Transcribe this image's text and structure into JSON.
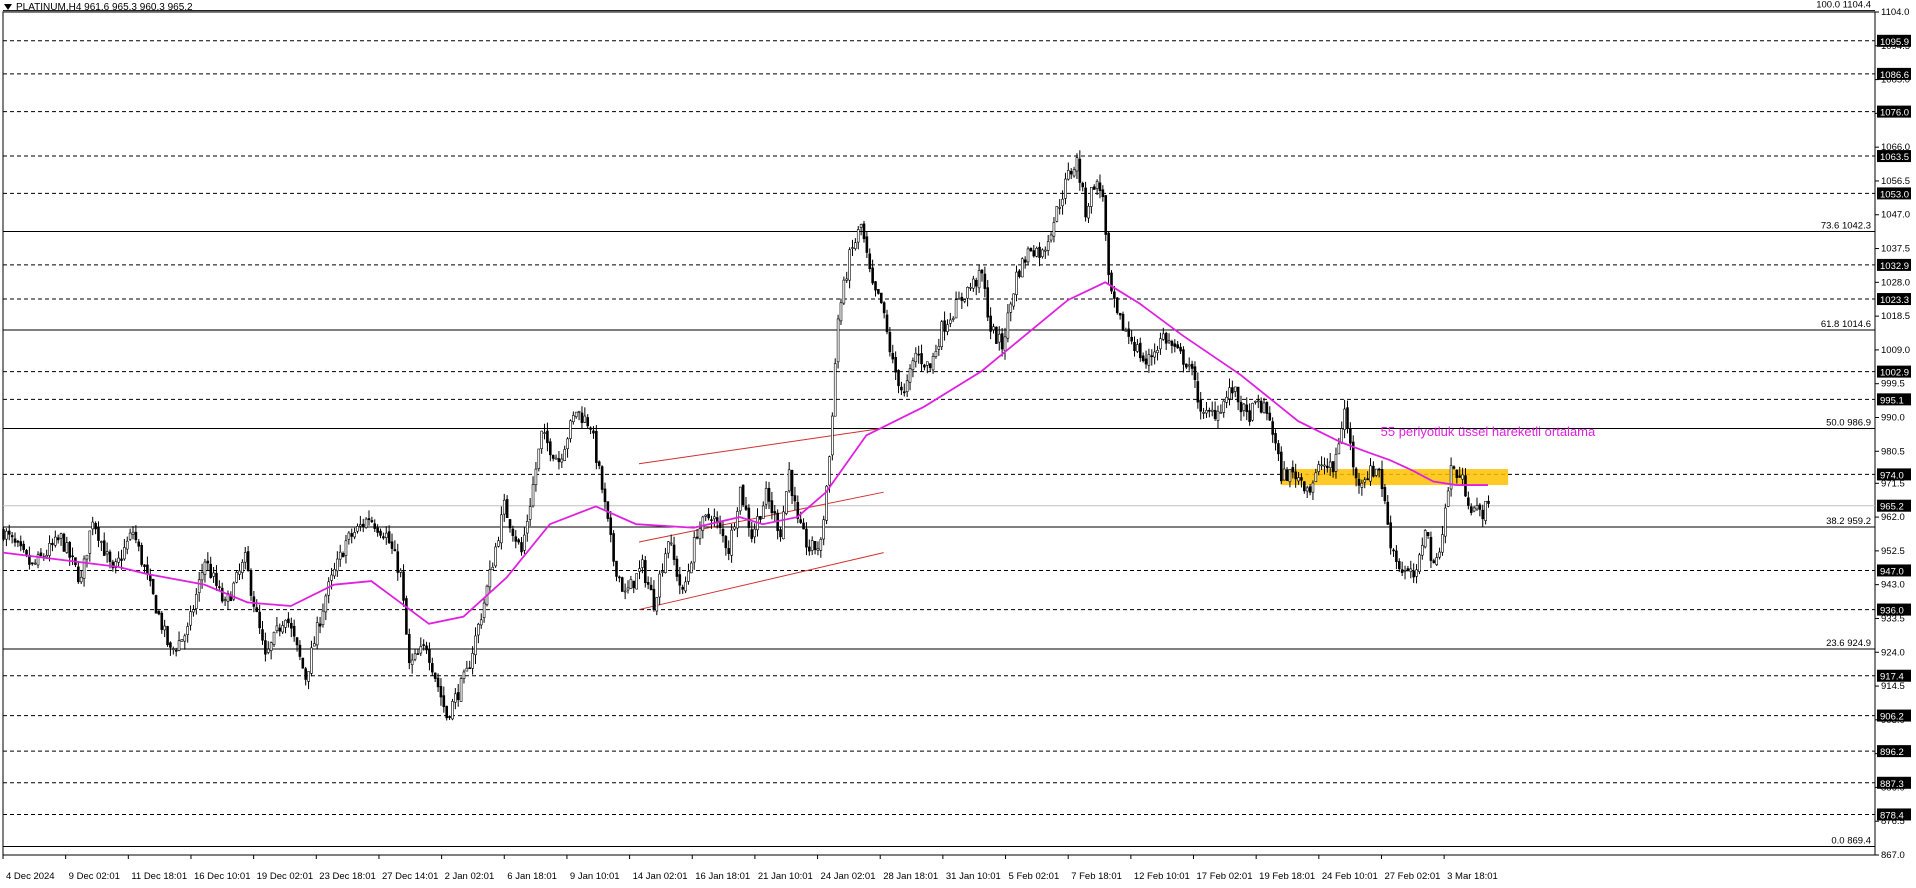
{
  "header": {
    "title": "PLATINUM,H4 961.6 965.3 960.3 965.2"
  },
  "annotation": {
    "ema_text": "55 periyotluk üssel hareketli ortalama",
    "ema_color": "#e020e0"
  },
  "colors": {
    "background": "#ffffff",
    "candles": "#000000",
    "ema": "#e020e0",
    "channel": "#d03030",
    "zone": "#ffc000",
    "grid": "#000000"
  },
  "chart_data": {
    "type": "candlestick",
    "ylim": [
      867.0,
      1104.0
    ],
    "x_tick_labels": [
      "4 Dec 2024",
      "9 Dec 02:01",
      "11 Dec 18:01",
      "16 Dec 10:01",
      "19 Dec 02:01",
      "23 Dec 18:01",
      "27 Dec 14:01",
      "2 Jan 02:01",
      "6 Jan 18:01",
      "9 Jan 10:01",
      "14 Jan 02:01",
      "16 Jan 18:01",
      "21 Jan 10:01",
      "24 Jan 02:01",
      "28 Jan 18:01",
      "31 Jan 10:01",
      "5 Feb 02:01",
      "7 Feb 18:01",
      "12 Feb 10:01",
      "17 Feb 02:01",
      "19 Feb 18:01",
      "24 Feb 10:01",
      "27 Feb 02:01",
      "3 Mar 18:01"
    ],
    "y_tick_labels": [
      1104.0,
      1094.5,
      1085.0,
      1075.5,
      1066.0,
      1056.5,
      1047.0,
      1037.5,
      1028.0,
      1018.5,
      1009.0,
      999.5,
      990.0,
      980.5,
      971.5,
      962.0,
      952.5,
      943.0,
      933.5,
      924.0,
      914.5,
      905.0,
      895.5,
      886.0,
      876.5,
      867.0
    ],
    "fib_levels": [
      {
        "label": "100.0 1104.4",
        "value": 1104.4
      },
      {
        "label": "73.6 1042.3",
        "value": 1042.3
      },
      {
        "label": "61.8 1014.6",
        "value": 1014.6
      },
      {
        "label": "50.0 986.9",
        "value": 986.9
      },
      {
        "label": "38.2 959.2",
        "value": 959.2
      },
      {
        "label": "23.6 924.9",
        "value": 924.9
      },
      {
        "label": "0.0 869.4",
        "value": 869.4
      }
    ],
    "horizontal_levels": [
      1095.9,
      1086.6,
      1076.0,
      1063.5,
      1053.0,
      1032.9,
      1023.3,
      1002.9,
      995.1,
      974.0,
      947.0,
      936.0,
      917.4,
      906.2,
      896.2,
      887.3,
      878.4
    ],
    "price_tags": [
      "1095.9",
      "1086.6",
      "1076.0",
      "1063.5",
      "1053.0",
      "1032.9",
      "1023.3",
      "1002.9",
      "995.1",
      "974.0",
      "965.2",
      "947.0",
      "936.0",
      "917.4",
      "906.2",
      "896.2",
      "887.3",
      "878.4"
    ],
    "current_price": 965.2,
    "price_path": [
      [
        0,
        958
      ],
      [
        10,
        948
      ],
      [
        20,
        956
      ],
      [
        27,
        944
      ],
      [
        31,
        962
      ],
      [
        38,
        946
      ],
      [
        45,
        958
      ],
      [
        51,
        942
      ],
      [
        58,
        924
      ],
      [
        64,
        930
      ],
      [
        70,
        950
      ],
      [
        77,
        937
      ],
      [
        84,
        950
      ],
      [
        91,
        922
      ],
      [
        98,
        935
      ],
      [
        105,
        917
      ],
      [
        112,
        940
      ],
      [
        119,
        955
      ],
      [
        127,
        962
      ],
      [
        133,
        957
      ],
      [
        138,
        946
      ],
      [
        141,
        920
      ],
      [
        147,
        926
      ],
      [
        154,
        906
      ],
      [
        161,
        918
      ],
      [
        167,
        938
      ],
      [
        174,
        965
      ],
      [
        180,
        952
      ],
      [
        187,
        985
      ],
      [
        193,
        978
      ],
      [
        199,
        992
      ],
      [
        204,
        988
      ],
      [
        208,
        970
      ],
      [
        212,
        950
      ],
      [
        216,
        940
      ],
      [
        222,
        948
      ],
      [
        226,
        938
      ],
      [
        231,
        956
      ],
      [
        236,
        940
      ],
      [
        241,
        958
      ],
      [
        246,
        963
      ],
      [
        252,
        953
      ],
      [
        256,
        970
      ],
      [
        260,
        957
      ],
      [
        265,
        968
      ],
      [
        270,
        958
      ],
      [
        273,
        975
      ],
      [
        276,
        960
      ],
      [
        280,
        953
      ],
      [
        284,
        954
      ],
      [
        287,
        979
      ],
      [
        290,
        1018
      ],
      [
        294,
        1035
      ],
      [
        298,
        1044
      ],
      [
        302,
        1026
      ],
      [
        305,
        1022
      ],
      [
        309,
        1005
      ],
      [
        313,
        996
      ],
      [
        317,
        1008
      ],
      [
        322,
        1004
      ],
      [
        326,
        1015
      ],
      [
        330,
        1020
      ],
      [
        335,
        1026
      ],
      [
        340,
        1030
      ],
      [
        343,
        1015
      ],
      [
        347,
        1010
      ],
      [
        352,
        1030
      ],
      [
        357,
        1038
      ],
      [
        361,
        1036
      ],
      [
        366,
        1048
      ],
      [
        370,
        1058
      ],
      [
        373,
        1062
      ],
      [
        376,
        1048
      ],
      [
        379,
        1056
      ],
      [
        382,
        1053
      ],
      [
        384,
        1028
      ],
      [
        387,
        1018
      ],
      [
        392,
        1012
      ],
      [
        397,
        1005
      ],
      [
        403,
        1013
      ],
      [
        408,
        1008
      ],
      [
        412,
        1005
      ],
      [
        417,
        990
      ],
      [
        422,
        992
      ],
      [
        427,
        998
      ],
      [
        432,
        990
      ],
      [
        436,
        994
      ],
      [
        440,
        990
      ],
      [
        444,
        974
      ],
      [
        449,
        974
      ],
      [
        454,
        970
      ],
      [
        458,
        977
      ],
      [
        462,
        975
      ],
      [
        466,
        992
      ],
      [
        470,
        972
      ],
      [
        474,
        974
      ],
      [
        478,
        976
      ],
      [
        482,
        955
      ],
      [
        485,
        948
      ],
      [
        488,
        946
      ],
      [
        491,
        945
      ],
      [
        494,
        960
      ],
      [
        497,
        947
      ],
      [
        500,
        958
      ],
      [
        503,
        976
      ],
      [
        507,
        972
      ],
      [
        510,
        965
      ],
      [
        513,
        963
      ],
      [
        516,
        965
      ]
    ],
    "ema55": [
      [
        0,
        952
      ],
      [
        20,
        950
      ],
      [
        40,
        948
      ],
      [
        50,
        946
      ],
      [
        70,
        943
      ],
      [
        85,
        938
      ],
      [
        100,
        937
      ],
      [
        115,
        943
      ],
      [
        128,
        944
      ],
      [
        138,
        938
      ],
      [
        148,
        932
      ],
      [
        160,
        934
      ],
      [
        175,
        945
      ],
      [
        190,
        960
      ],
      [
        206,
        965
      ],
      [
        220,
        960
      ],
      [
        240,
        959
      ],
      [
        256,
        962
      ],
      [
        264,
        960
      ],
      [
        276,
        962
      ],
      [
        286,
        969
      ],
      [
        300,
        985
      ],
      [
        320,
        993
      ],
      [
        340,
        1003
      ],
      [
        355,
        1013
      ],
      [
        370,
        1023
      ],
      [
        383,
        1028
      ],
      [
        395,
        1022
      ],
      [
        410,
        1013
      ],
      [
        430,
        1002
      ],
      [
        450,
        989
      ],
      [
        465,
        983
      ],
      [
        475,
        980
      ],
      [
        482,
        978
      ],
      [
        490,
        975
      ],
      [
        497,
        972
      ],
      [
        505,
        971
      ],
      [
        516,
        971
      ]
    ],
    "channel_lines": [
      [
        [
          221,
          977
        ],
        [
          306,
          987
        ]
      ],
      [
        [
          221,
          955
        ],
        [
          306,
          969
        ]
      ],
      [
        [
          221,
          936
        ],
        [
          306,
          952
        ]
      ]
    ],
    "zone": {
      "x_start": 444,
      "x_end": 523,
      "y_low": 971.0,
      "y_high": 975.5
    }
  }
}
